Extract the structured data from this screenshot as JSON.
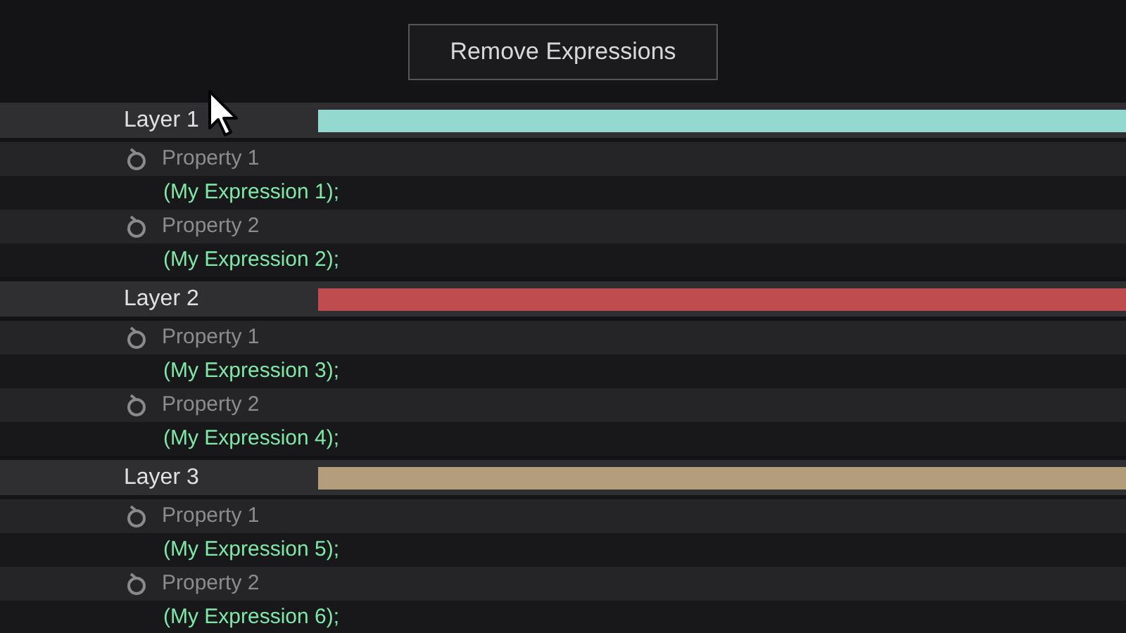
{
  "button": "Remove Expressions",
  "layers": [
    {
      "name": "Layer 1",
      "color": "#94d9d0",
      "properties": [
        {
          "name": "Property 1",
          "expression": "(My Expression 1);"
        },
        {
          "name": "Property 2",
          "expression": "(My Expression 2);"
        }
      ]
    },
    {
      "name": "Layer 2",
      "color": "#bf4c4f",
      "properties": [
        {
          "name": "Property 1",
          "expression": "(My Expression 3);"
        },
        {
          "name": "Property 2",
          "expression": "(My Expression 4);"
        }
      ]
    },
    {
      "name": "Layer 3",
      "color": "#b39d7c",
      "properties": [
        {
          "name": "Property 1",
          "expression": "(My Expression 5);"
        },
        {
          "name": "Property 2",
          "expression": "(My Expression 6);"
        }
      ]
    }
  ]
}
